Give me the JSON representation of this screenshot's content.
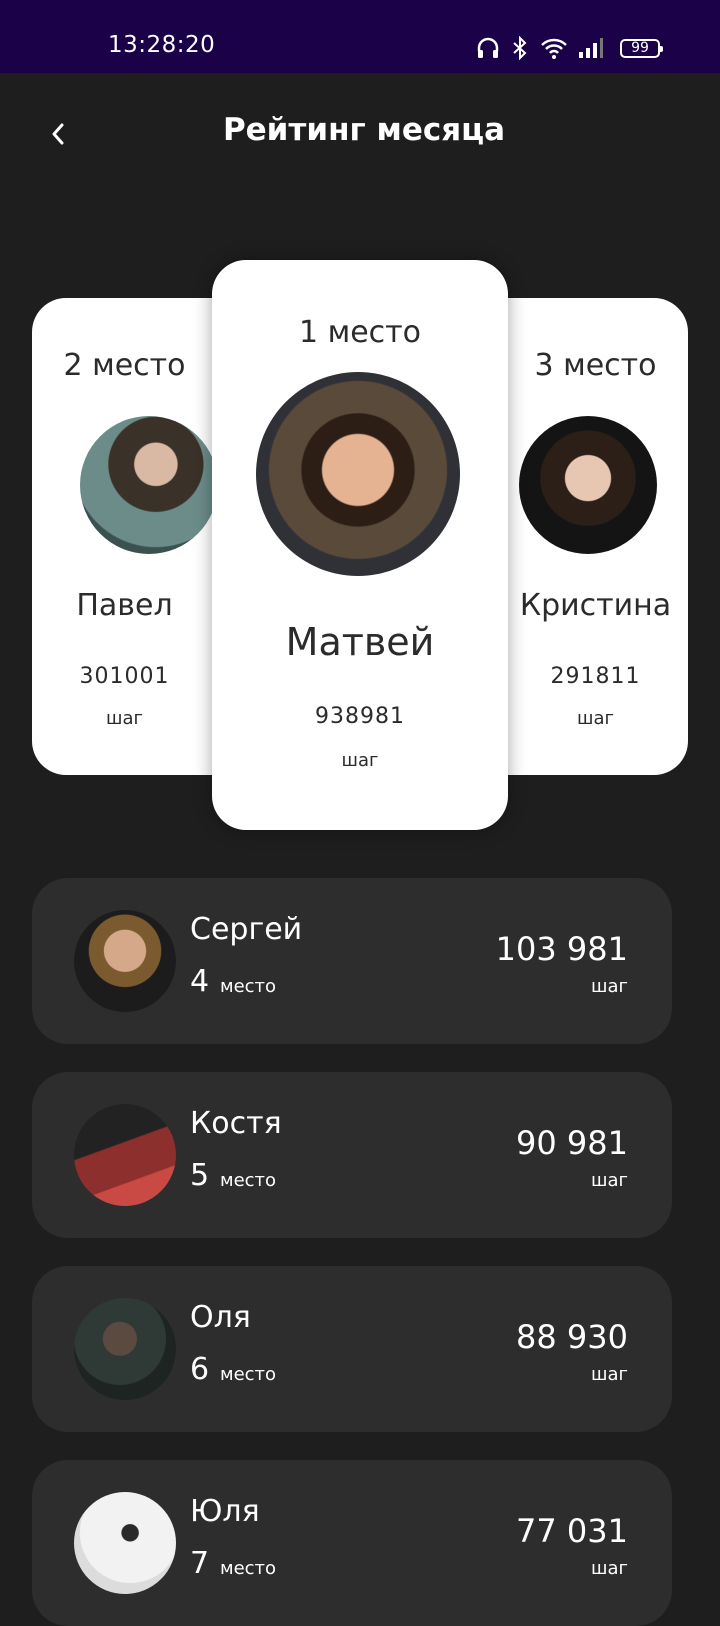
{
  "status_bar": {
    "time": "13:28:20",
    "battery": "99",
    "icons": [
      "headphones-icon",
      "bluetooth-icon",
      "wifi-icon",
      "signal-icon",
      "battery-icon"
    ],
    "background": "#1a0148"
  },
  "header": {
    "title": "Рейтинг месяца",
    "back_icon": "chevron-left-icon"
  },
  "podium": {
    "first": {
      "place": "1 место",
      "name": "Матвей",
      "steps": "938981",
      "unit": "шаг"
    },
    "second": {
      "place": "2 место",
      "name": "Павел",
      "steps": "301001",
      "unit": "шаг"
    },
    "third": {
      "place": "3 место",
      "name": "Кристина",
      "steps": "291811",
      "unit": "шаг"
    }
  },
  "list": [
    {
      "name": "Сергей",
      "place_num": "4",
      "place_label": "место",
      "steps": "103 981",
      "unit": "шаг"
    },
    {
      "name": "Костя",
      "place_num": "5",
      "place_label": "место",
      "steps": "90 981",
      "unit": "шаг"
    },
    {
      "name": "Оля",
      "place_num": "6",
      "place_label": "место",
      "steps": "88 930",
      "unit": "шаг"
    },
    {
      "name": "Юля",
      "place_num": "7",
      "place_label": "место",
      "steps": "77 031",
      "unit": "шаг"
    }
  ],
  "colors": {
    "background": "#1e1e1e",
    "card": "#2d2d2d",
    "podium_card": "#ffffff"
  }
}
